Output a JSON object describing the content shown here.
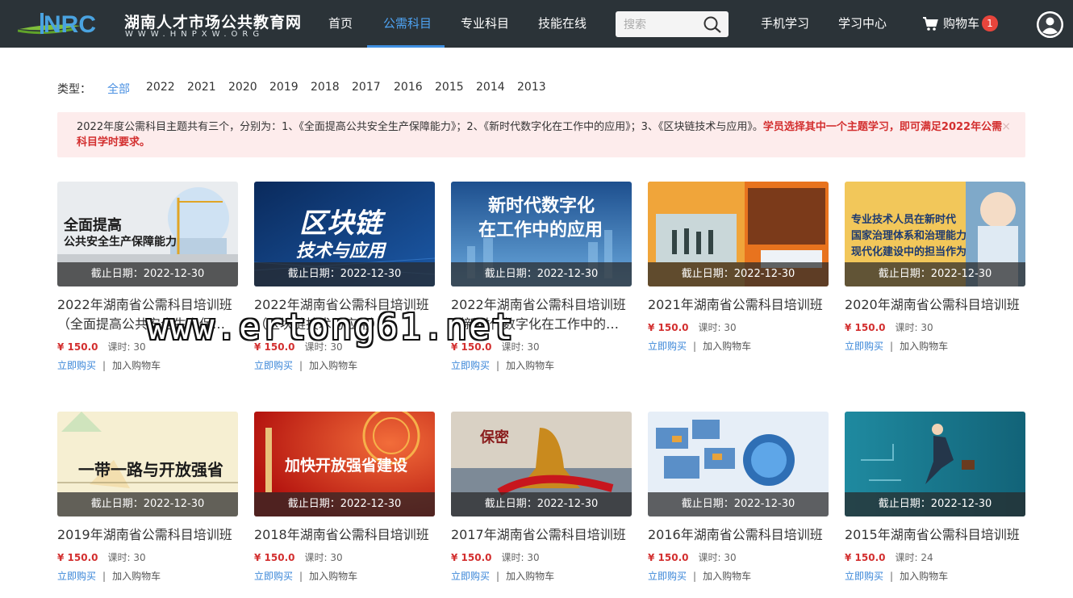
{
  "header": {
    "logo_title": "湖南人才市场公共教育网",
    "logo_sub": "WWW.HNPXW.ORG",
    "nav": [
      "首页",
      "公需科目",
      "专业科目",
      "技能在线"
    ],
    "search_placeholder": "搜索",
    "mobile": "手机学习",
    "study_center": "学习中心",
    "cart_label": "购物车",
    "cart_count": "1"
  },
  "filter": {
    "label": "类型：",
    "options": [
      "全部",
      "2022",
      "2021",
      "2020",
      "2019",
      "2018",
      "2017",
      "2016",
      "2015",
      "2014",
      "2013"
    ],
    "active": "全部"
  },
  "notice": {
    "text": "2022年度公需科目主题共有三个，分别为：1、《全面提高公共安全生产保障能力》；2、《新时代数字化在工作中的应用》；3、《区块链技术与应用》。",
    "highlight": "学员选择其中一个主题学习，即可满足2022年公需科目学时要求。",
    "close": "×"
  },
  "courses": [
    {
      "thumb_lines": [
        "全面提高",
        "公共安全生产保障能力"
      ],
      "deadline": "截止日期：2022-12-30",
      "title1": "2022年湖南省公需科目培训班",
      "title2": "（全面提高公共安全生产保障能力）",
      "price": "¥ 150.0",
      "hours": "课时: 30",
      "buy": "立即购买",
      "sep": "|",
      "add": "加入购物车"
    },
    {
      "thumb_lines": [
        "区块链",
        "技术与应用"
      ],
      "deadline": "截止日期：2022-12-30",
      "title1": "2022年湖南省公需科目培训班",
      "title2": "（区块链技术与应用）",
      "price": "¥ 150.0",
      "hours": "课时: 30",
      "buy": "立即购买",
      "sep": "|",
      "add": "加入购物车"
    },
    {
      "thumb_lines": [
        "新时代数字化",
        "在工作中的应用"
      ],
      "deadline": "截止日期：2022-12-30",
      "title1": "2022年湖南省公需科目培训班",
      "title2": "（新时代数字化在工作中的应用）",
      "price": "¥ 150.0",
      "hours": "课时: 30",
      "buy": "立即购买",
      "sep": "|",
      "add": "加入购物车"
    },
    {
      "thumb_lines": [],
      "deadline": "截止日期：2022-12-30",
      "title1": "2021年湖南省公需科目培训班",
      "title2": "",
      "price": "¥ 150.0",
      "hours": "课时: 30",
      "buy": "立即购买",
      "sep": "|",
      "add": "加入购物车"
    },
    {
      "thumb_lines": [
        "专业技术人员在新时代",
        "国家治理体系和治理能力",
        "现代化建设中的担当作为"
      ],
      "deadline": "截止日期：2022-12-30",
      "title1": "2020年湖南省公需科目培训班",
      "title2": "",
      "price": "¥ 150.0",
      "hours": "课时: 30",
      "buy": "立即购买",
      "sep": "|",
      "add": "加入购物车"
    },
    {
      "thumb_lines": [
        "一带一路与开放强省"
      ],
      "deadline": "截止日期：2022-12-30",
      "title1": "2019年湖南省公需科目培训班",
      "title2": "",
      "price": "¥ 150.0",
      "hours": "课时: 30",
      "buy": "立即购买",
      "sep": "|",
      "add": "加入购物车"
    },
    {
      "thumb_lines": [
        "加快开放强省建设"
      ],
      "deadline": "截止日期：2022-12-30",
      "title1": "2018年湖南省公需科目培训班",
      "title2": "",
      "price": "¥ 150.0",
      "hours": "课时: 30",
      "buy": "立即购买",
      "sep": "|",
      "add": "加入购物车"
    },
    {
      "thumb_lines": [
        "保密"
      ],
      "deadline": "截止日期：2022-12-30",
      "title1": "2017年湖南省公需科目培训班",
      "title2": "",
      "price": "¥ 150.0",
      "hours": "课时: 30",
      "buy": "立即购买",
      "sep": "|",
      "add": "加入购物车"
    },
    {
      "thumb_lines": [],
      "deadline": "截止日期：2022-12-30",
      "title1": "2016年湖南省公需科目培训班",
      "title2": "",
      "price": "¥ 150.0",
      "hours": "课时: 30",
      "buy": "立即购买",
      "sep": "|",
      "add": "加入购物车"
    },
    {
      "thumb_lines": [],
      "deadline": "截止日期：2022-12-30",
      "title1": "2015年湖南省公需科目培训班",
      "title2": "",
      "price": "¥ 150.0",
      "hours": "课时: 24",
      "buy": "立即购买",
      "sep": "|",
      "add": "加入购物车"
    }
  ],
  "watermark": "www.ertong61.net",
  "colors": {
    "header_bg": "#2b3338",
    "accent": "#4a90e2",
    "price": "#d32f2f",
    "badge": "#e8453c",
    "notice_bg": "#fdecec"
  }
}
